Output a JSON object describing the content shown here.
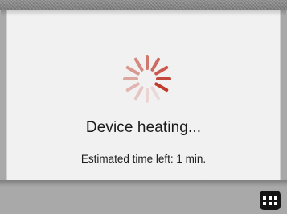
{
  "screen": {
    "status_title": "Device heating...",
    "status_detail": "Estimated time left: 1 min."
  },
  "spinner": {
    "icon": "loading-spinner-icon",
    "accent_color": "#c0392b"
  },
  "footer": {
    "menu_icon": "grid-menu-icon"
  }
}
